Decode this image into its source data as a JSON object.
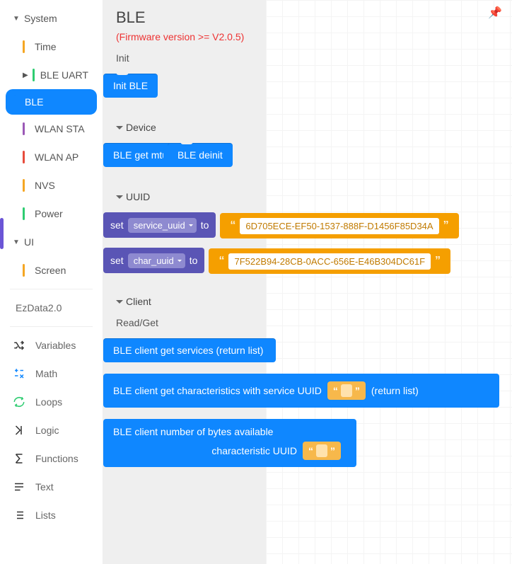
{
  "sidebar": {
    "groups": [
      {
        "label": "System",
        "expanded": true,
        "items": [
          {
            "label": "Time",
            "color": "#f5a623"
          },
          {
            "label": "BLE UART",
            "color": "#2ecc71",
            "arrow": true
          },
          {
            "label": "BLE",
            "color": "#0f87ff",
            "selected": true
          },
          {
            "label": "WLAN STA",
            "color": "#9b59b6"
          },
          {
            "label": "WLAN AP",
            "color": "#e74c3c"
          },
          {
            "label": "NVS",
            "color": "#f5a623"
          },
          {
            "label": "Power",
            "color": "#2ecc71"
          }
        ]
      },
      {
        "label": "UI",
        "expanded": true,
        "items": [
          {
            "label": "Screen",
            "color": "#f5a623"
          }
        ]
      }
    ],
    "extra": {
      "label": "EzData2.0"
    },
    "utils": [
      {
        "label": "Variables",
        "icon": "shuffle",
        "color": "#333"
      },
      {
        "label": "Math",
        "icon": "math",
        "color": "#0f87ff"
      },
      {
        "label": "Loops",
        "icon": "loop",
        "color": "#2ecc71"
      },
      {
        "label": "Logic",
        "icon": "logic",
        "color": "#333"
      },
      {
        "label": "Functions",
        "icon": "sigma",
        "color": "#333"
      },
      {
        "label": "Text",
        "icon": "text",
        "color": "#333"
      },
      {
        "label": "Lists",
        "icon": "list",
        "color": "#333"
      }
    ]
  },
  "panel": {
    "title": "BLE",
    "note": "(Firmware version >= V2.0.5)",
    "init_label": "Init",
    "init_block": "Init BLE",
    "device_header": "Device",
    "get_mtu": "BLE get mtu",
    "deinit": "BLE deinit",
    "uuid_header": "UUID",
    "set_word": "set",
    "to_word": "to",
    "service_field": "service_uuid",
    "service_value": "6D705ECE-EF50-1537-888F-D1456F85D34A",
    "char_field": "char_uuid",
    "char_value": "7F522B94-28CB-0ACC-656E-E46B304DC61F",
    "client_header": "Client",
    "readget": "Read/Get",
    "client_services": "BLE client get services (return list)",
    "client_char_pre": "BLE client get characteristics with service UUID",
    "client_char_post": "(return list)",
    "client_bytes_l1": "BLE client number of bytes available",
    "client_bytes_l2": "characteristic UUID"
  }
}
